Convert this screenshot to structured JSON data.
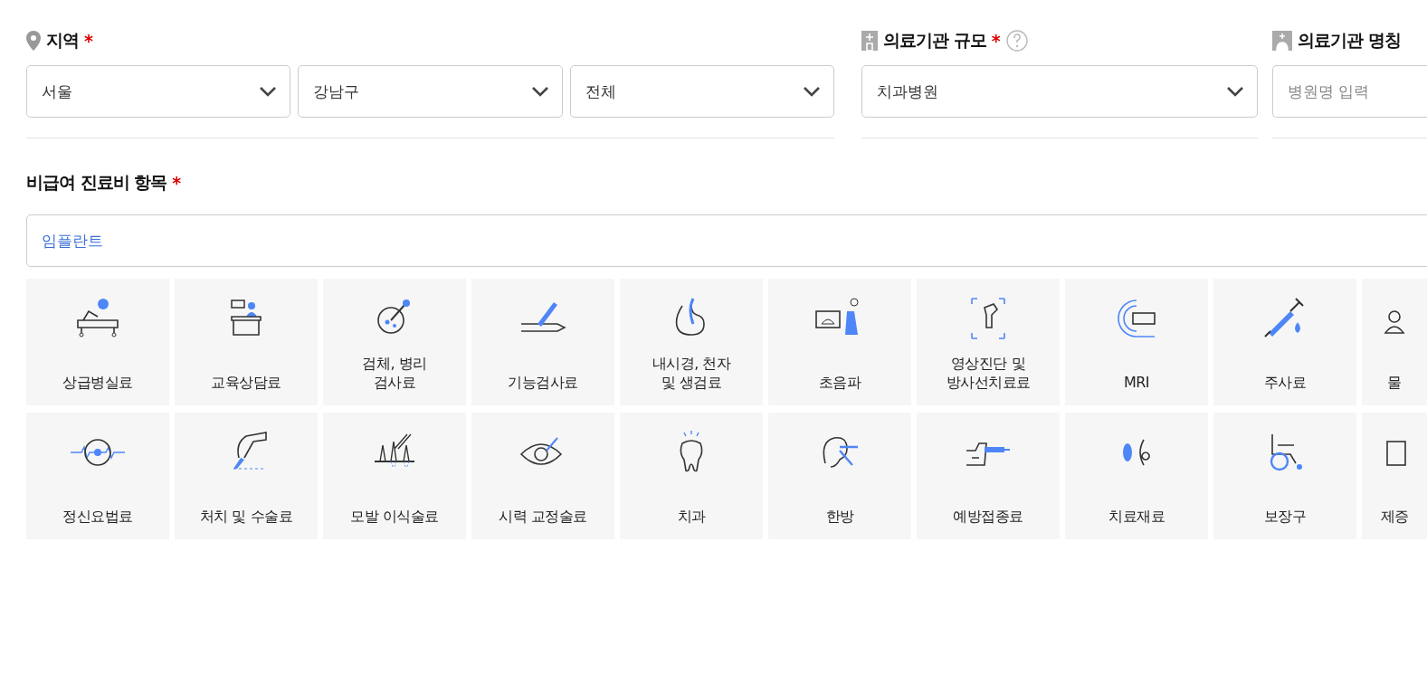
{
  "region": {
    "label": "지역",
    "required_mark": "*",
    "selects": [
      "서울",
      "강남구",
      "전체"
    ]
  },
  "scale": {
    "label": "의료기관 규모",
    "required_mark": "*",
    "select": "치과병원"
  },
  "name": {
    "label": "의료기관 명칭",
    "placeholder": "병원명 입력"
  },
  "items": {
    "label": "비급여 진료비 항목",
    "required_mark": "*",
    "search_value": "임플란트",
    "tiles": [
      {
        "label": "상급병실료"
      },
      {
        "label": "교육상담료"
      },
      {
        "label": "검체, 병리\n검사료"
      },
      {
        "label": "기능검사료"
      },
      {
        "label": "내시경, 천자\n및 생검료"
      },
      {
        "label": "초음파"
      },
      {
        "label": "영상진단 및\n방사선치료료"
      },
      {
        "label": "MRI"
      },
      {
        "label": "주사료"
      },
      {
        "label": "물"
      },
      {
        "label": "정신요법료"
      },
      {
        "label": "처치 및 수술료"
      },
      {
        "label": "모발 이식술료"
      },
      {
        "label": "시력 교정술료"
      },
      {
        "label": "치과"
      },
      {
        "label": "한방"
      },
      {
        "label": "예방접종료"
      },
      {
        "label": "치료재료"
      },
      {
        "label": "보장구"
      },
      {
        "label": "제증"
      }
    ]
  }
}
